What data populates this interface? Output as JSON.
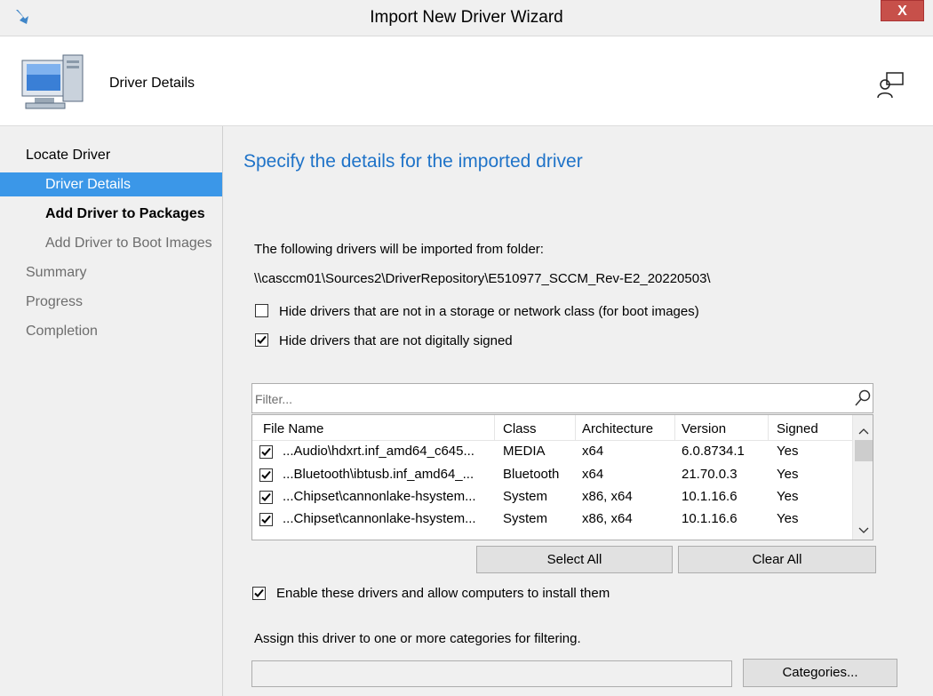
{
  "window": {
    "title": "Import New Driver Wizard",
    "close_label": "X"
  },
  "header": {
    "page_title": "Driver Details"
  },
  "nav": {
    "items": [
      {
        "label": "Locate Driver"
      },
      {
        "label": "Driver Details"
      },
      {
        "label": "Add Driver to Packages"
      },
      {
        "label": "Add Driver to Boot Images"
      },
      {
        "label": "Summary"
      },
      {
        "label": "Progress"
      },
      {
        "label": "Completion"
      }
    ]
  },
  "main": {
    "heading": "Specify the details for the imported driver",
    "folder_label": "The following drivers will be imported from folder:",
    "folder_path": "\\\\casccm01\\Sources2\\DriverRepository\\E510977_SCCM_Rev-E2_20220503\\",
    "hide_storage_label": "Hide drivers that are not in a storage or network class (for boot images)",
    "hide_storage_checked": false,
    "hide_unsigned_label": "Hide drivers that are not digitally signed",
    "hide_unsigned_checked": true,
    "filter_placeholder": "Filter...",
    "table": {
      "columns": [
        "File Name",
        "Class",
        "Architecture",
        "Version",
        "Signed"
      ],
      "rows": [
        {
          "checked": true,
          "file": "...Audio\\hdxrt.inf_amd64_c645...",
          "class": "MEDIA",
          "arch": "x64",
          "version": "6.0.8734.1",
          "signed": "Yes"
        },
        {
          "checked": true,
          "file": "...Bluetooth\\ibtusb.inf_amd64_...",
          "class": "Bluetooth",
          "arch": "x64",
          "version": "21.70.0.3",
          "signed": "Yes"
        },
        {
          "checked": true,
          "file": "...Chipset\\cannonlake-hsystem...",
          "class": "System",
          "arch": "x86, x64",
          "version": "10.1.16.6",
          "signed": "Yes"
        },
        {
          "checked": true,
          "file": "...Chipset\\cannonlake-hsystem...",
          "class": "System",
          "arch": "x86, x64",
          "version": "10.1.16.6",
          "signed": "Yes"
        }
      ]
    },
    "select_all_label": "Select All",
    "clear_all_label": "Clear All",
    "enable_label": "Enable these drivers and allow computers to install them",
    "enable_checked": true,
    "categories_label": "Assign this driver to one or more categories for filtering.",
    "categories_value": "",
    "categories_button": "Categories..."
  }
}
